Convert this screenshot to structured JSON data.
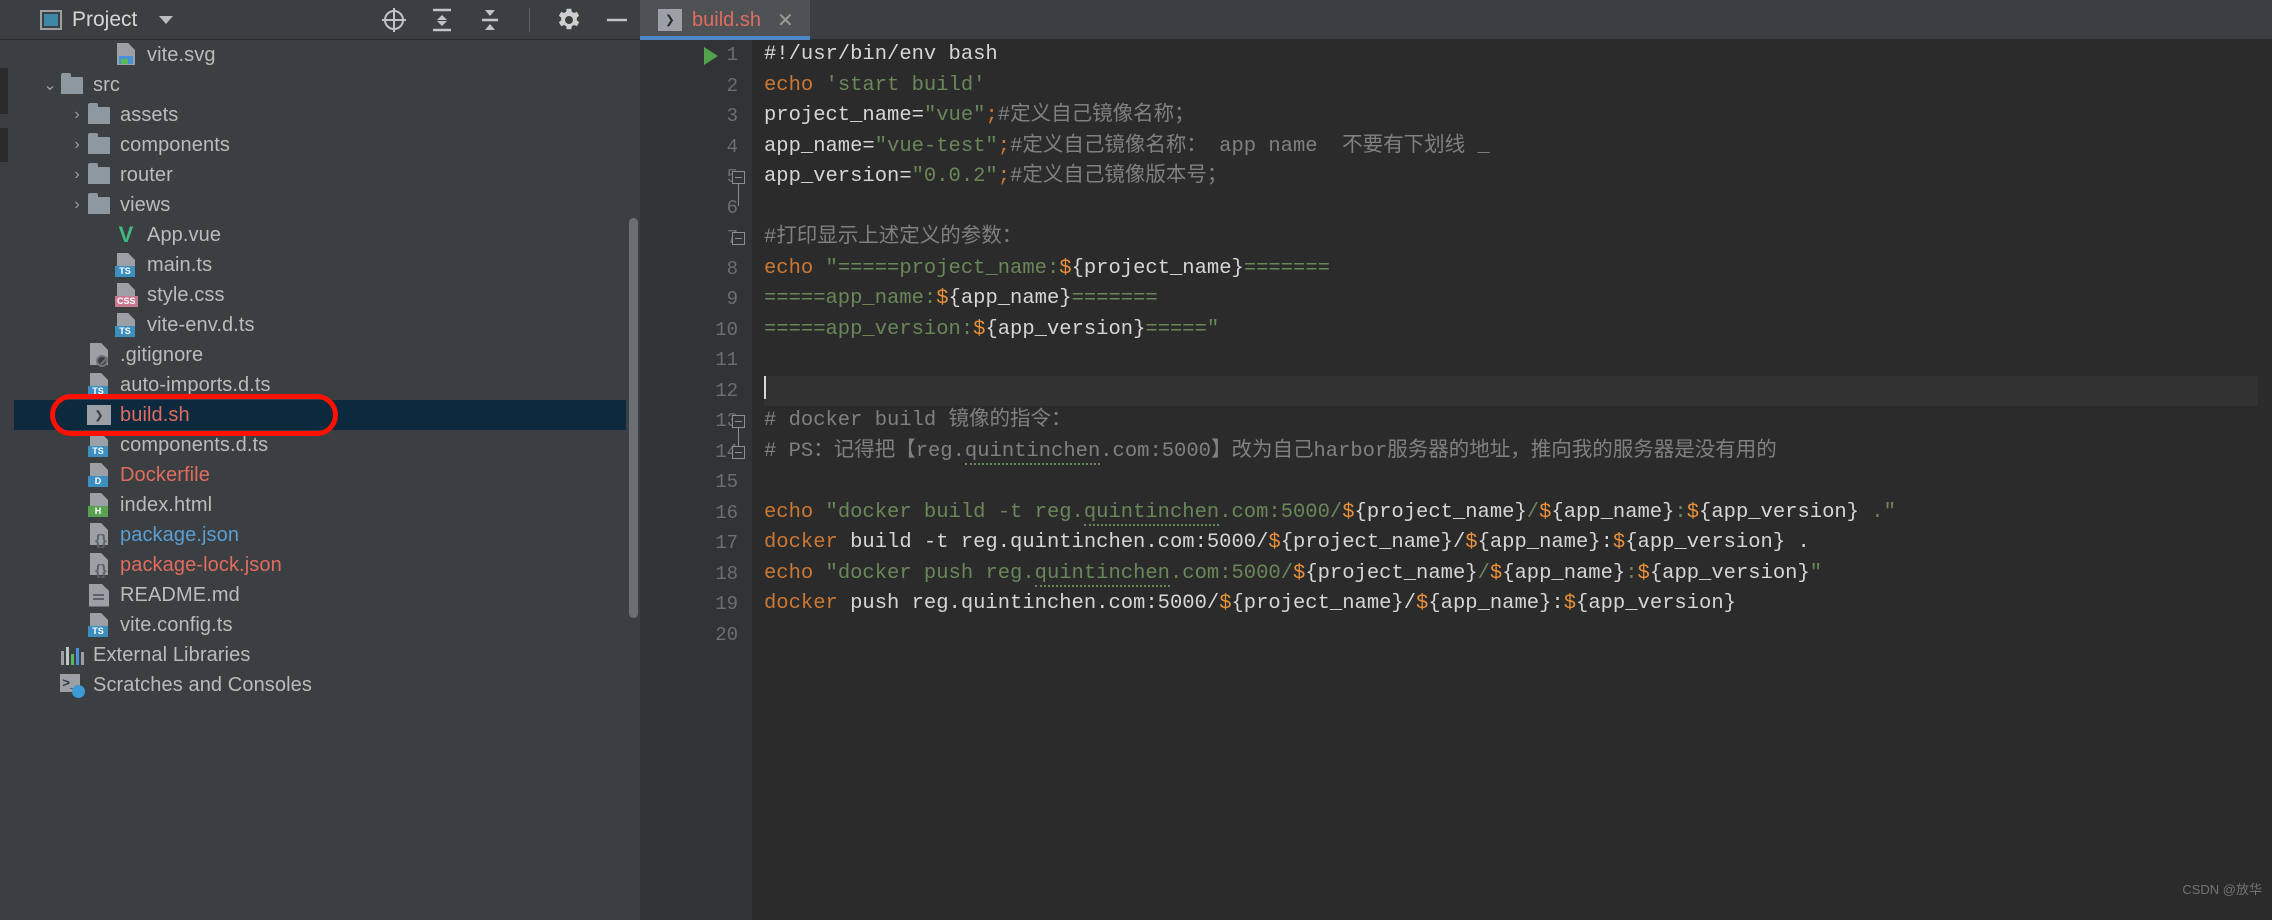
{
  "window": {
    "panel_title": "Project",
    "toolbar_icons": [
      "locate-icon",
      "expand-all-icon",
      "collapse-all-icon",
      "gear-icon",
      "minimize-icon"
    ]
  },
  "tab": {
    "name": "build.sh",
    "icon": "shell-script-icon",
    "close": "✕",
    "badge": "❯"
  },
  "sidebar": {
    "items": [
      {
        "label": "vite.svg",
        "indent": 3,
        "arrow": "",
        "icon": "svg-file-icon",
        "color": "grey"
      },
      {
        "label": "src",
        "indent": 1,
        "arrow": "⌄",
        "icon": "folder-icon",
        "color": "grey"
      },
      {
        "label": "assets",
        "indent": 2,
        "arrow": "›",
        "icon": "folder-icon",
        "color": "grey"
      },
      {
        "label": "components",
        "indent": 2,
        "arrow": "›",
        "icon": "folder-icon",
        "color": "grey"
      },
      {
        "label": "router",
        "indent": 2,
        "arrow": "›",
        "icon": "folder-icon",
        "color": "grey"
      },
      {
        "label": "views",
        "indent": 2,
        "arrow": "›",
        "icon": "folder-icon",
        "color": "grey"
      },
      {
        "label": "App.vue",
        "indent": 3,
        "arrow": "",
        "icon": "vue-file-icon",
        "color": "grey"
      },
      {
        "label": "main.ts",
        "indent": 3,
        "arrow": "",
        "icon": "ts-file-icon",
        "color": "grey"
      },
      {
        "label": "style.css",
        "indent": 3,
        "arrow": "",
        "icon": "css-file-icon",
        "color": "grey"
      },
      {
        "label": "vite-env.d.ts",
        "indent": 3,
        "arrow": "",
        "icon": "ts-file-icon",
        "color": "grey"
      },
      {
        "label": ".gitignore",
        "indent": 2,
        "arrow": "",
        "icon": "gitignore-file-icon",
        "color": "grey"
      },
      {
        "label": "auto-imports.d.ts",
        "indent": 2,
        "arrow": "",
        "icon": "ts-file-icon",
        "color": "grey"
      },
      {
        "label": "build.sh",
        "indent": 2,
        "arrow": "",
        "icon": "shell-script-icon",
        "color": "red",
        "selected": true
      },
      {
        "label": "components.d.ts",
        "indent": 2,
        "arrow": "",
        "icon": "ts-file-icon",
        "color": "grey"
      },
      {
        "label": "Dockerfile",
        "indent": 2,
        "arrow": "",
        "icon": "docker-file-icon",
        "color": "red"
      },
      {
        "label": "index.html",
        "indent": 2,
        "arrow": "",
        "icon": "html-file-icon",
        "color": "grey"
      },
      {
        "label": "package.json",
        "indent": 2,
        "arrow": "",
        "icon": "json-file-icon",
        "color": "blue"
      },
      {
        "label": "package-lock.json",
        "indent": 2,
        "arrow": "",
        "icon": "json-file-icon",
        "color": "red"
      },
      {
        "label": "README.md",
        "indent": 2,
        "arrow": "",
        "icon": "markdown-file-icon",
        "color": "grey"
      },
      {
        "label": "vite.config.ts",
        "indent": 2,
        "arrow": "",
        "icon": "ts-file-icon",
        "color": "grey"
      },
      {
        "label": "External Libraries",
        "indent": 1,
        "arrow": "",
        "icon": "external-libraries-icon",
        "color": "grey"
      },
      {
        "label": "Scratches and Consoles",
        "indent": 1,
        "arrow": "",
        "icon": "scratches-icon",
        "color": "grey"
      }
    ],
    "tags": {
      "ts": "TS",
      "css": "CSS",
      "d": "D",
      "h": "H"
    }
  },
  "editor": {
    "line_numbers": [
      "1",
      "2",
      "3",
      "4",
      "5",
      "6",
      "7",
      "8",
      "9",
      "10",
      "11",
      "12",
      "13",
      "14",
      "15",
      "16",
      "17",
      "18",
      "19",
      "20"
    ],
    "lines": [
      {
        "n": "1",
        "segments": [
          {
            "t": "#!/usr/bin/env bash",
            "c": "plain"
          }
        ]
      },
      {
        "n": "2",
        "segments": [
          {
            "t": "echo ",
            "c": "kw"
          },
          {
            "t": "'start build'",
            "c": "str"
          }
        ]
      },
      {
        "n": "3",
        "segments": [
          {
            "t": "project_name=",
            "c": "plain"
          },
          {
            "t": "\"vue\"",
            "c": "str"
          },
          {
            "t": ";",
            "c": "kw"
          },
          {
            "t": "#定义自己镜像名称；",
            "c": "comment"
          }
        ]
      },
      {
        "n": "4",
        "segments": [
          {
            "t": "app_name=",
            "c": "plain"
          },
          {
            "t": "\"vue-test\"",
            "c": "str"
          },
          {
            "t": ";",
            "c": "kw"
          },
          {
            "t": "#定义自己镜像名称： app name  不要有下划线 _",
            "c": "comment"
          }
        ]
      },
      {
        "n": "5",
        "segments": [
          {
            "t": "app_version=",
            "c": "plain"
          },
          {
            "t": "\"0.0.2\"",
            "c": "str"
          },
          {
            "t": ";",
            "c": "kw"
          },
          {
            "t": "#定义自己镜像版本号；",
            "c": "comment"
          }
        ]
      },
      {
        "n": "6",
        "segments": []
      },
      {
        "n": "7",
        "segments": [
          {
            "t": "#打印显示上述定义的参数：",
            "c": "comment"
          }
        ]
      },
      {
        "n": "8",
        "segments": [
          {
            "t": "echo ",
            "c": "kw"
          },
          {
            "t": "\"=====project_name:",
            "c": "str"
          },
          {
            "t": "$",
            "c": "orange"
          },
          {
            "t": "{project_name}",
            "c": "plain"
          },
          {
            "t": "=======",
            "c": "str"
          }
        ]
      },
      {
        "n": "9",
        "segments": [
          {
            "t": "=====app_name:",
            "c": "str"
          },
          {
            "t": "$",
            "c": "orange"
          },
          {
            "t": "{app_name}",
            "c": "plain"
          },
          {
            "t": "=======",
            "c": "str"
          }
        ]
      },
      {
        "n": "10",
        "segments": [
          {
            "t": "=====app_version:",
            "c": "str"
          },
          {
            "t": "$",
            "c": "orange"
          },
          {
            "t": "{app_version}",
            "c": "plain"
          },
          {
            "t": "=====\"",
            "c": "str"
          }
        ]
      },
      {
        "n": "11",
        "segments": []
      },
      {
        "n": "12",
        "segments": [],
        "cursor": true
      },
      {
        "n": "13",
        "segments": [
          {
            "t": "# docker build 镜像的指令：",
            "c": "comment"
          }
        ]
      },
      {
        "n": "14",
        "segments": [
          {
            "t": "# PS：记得把【reg.",
            "c": "comment"
          },
          {
            "t": "quintinchen",
            "c": "comment-squig"
          },
          {
            "t": ".com:5000】改为自己harbor服务器的地址，推向我的服务器是没有用的",
            "c": "comment"
          }
        ]
      },
      {
        "n": "15",
        "segments": []
      },
      {
        "n": "16",
        "segments": [
          {
            "t": "echo ",
            "c": "kw"
          },
          {
            "t": "\"docker build -t reg.",
            "c": "str"
          },
          {
            "t": "quintinchen",
            "c": "str-squig"
          },
          {
            "t": ".com:5000/",
            "c": "str"
          },
          {
            "t": "$",
            "c": "orange"
          },
          {
            "t": "{project_name}",
            "c": "plain"
          },
          {
            "t": "/",
            "c": "str"
          },
          {
            "t": "$",
            "c": "orange"
          },
          {
            "t": "{app_name}",
            "c": "plain"
          },
          {
            "t": ":",
            "c": "str"
          },
          {
            "t": "$",
            "c": "orange"
          },
          {
            "t": "{app_version}",
            "c": "plain"
          },
          {
            "t": " .\"",
            "c": "str"
          }
        ]
      },
      {
        "n": "17",
        "segments": [
          {
            "t": "docker",
            "c": "kw"
          },
          {
            "t": " build -t reg.quintinchen.com:5000/",
            "c": "plain"
          },
          {
            "t": "$",
            "c": "orange"
          },
          {
            "t": "{project_name}",
            "c": "plain"
          },
          {
            "t": "/",
            "c": "plain"
          },
          {
            "t": "$",
            "c": "orange"
          },
          {
            "t": "{app_name}",
            "c": "plain"
          },
          {
            "t": ":",
            "c": "plain"
          },
          {
            "t": "$",
            "c": "orange"
          },
          {
            "t": "{app_version}",
            "c": "plain"
          },
          {
            "t": " .",
            "c": "plain"
          }
        ]
      },
      {
        "n": "18",
        "segments": [
          {
            "t": "echo ",
            "c": "kw"
          },
          {
            "t": "\"docker push reg.",
            "c": "str"
          },
          {
            "t": "quintinchen",
            "c": "str-squig"
          },
          {
            "t": ".com:5000/",
            "c": "str"
          },
          {
            "t": "$",
            "c": "orange"
          },
          {
            "t": "{project_name}",
            "c": "plain"
          },
          {
            "t": "/",
            "c": "str"
          },
          {
            "t": "$",
            "c": "orange"
          },
          {
            "t": "{app_name}",
            "c": "plain"
          },
          {
            "t": ":",
            "c": "str"
          },
          {
            "t": "$",
            "c": "orange"
          },
          {
            "t": "{app_version}",
            "c": "plain"
          },
          {
            "t": "\"",
            "c": "str"
          }
        ]
      },
      {
        "n": "19",
        "segments": [
          {
            "t": "docker",
            "c": "kw"
          },
          {
            "t": " push reg.quintinchen.com:5000/",
            "c": "plain"
          },
          {
            "t": "$",
            "c": "orange"
          },
          {
            "t": "{project_name}",
            "c": "plain"
          },
          {
            "t": "/",
            "c": "plain"
          },
          {
            "t": "$",
            "c": "orange"
          },
          {
            "t": "{app_name}",
            "c": "plain"
          },
          {
            "t": ":",
            "c": "plain"
          },
          {
            "t": "$",
            "c": "orange"
          },
          {
            "t": "{app_version}",
            "c": "plain"
          }
        ]
      },
      {
        "n": "20",
        "segments": []
      }
    ],
    "watermark": "CSDN @放华"
  },
  "colors": {
    "accent_blue": "#4a88c7",
    "selection": "#0d293e",
    "annotation_red": "#ff1100",
    "file_red": "#e06c5f",
    "file_blue": "#5a9ed4",
    "editor_bg": "#2b2b2b",
    "panel_bg": "#3c3f41"
  }
}
